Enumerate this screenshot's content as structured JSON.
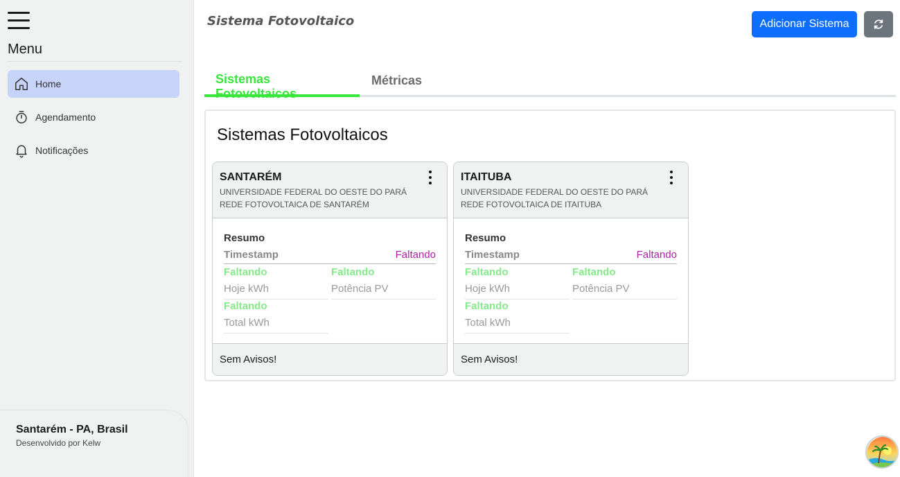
{
  "sidebar": {
    "menu_title": "Menu",
    "items": [
      {
        "label": "Home",
        "icon": "home-icon"
      },
      {
        "label": "Agendamento",
        "icon": "stopwatch-icon"
      },
      {
        "label": "Notificações",
        "icon": "bell-icon"
      }
    ],
    "footer": {
      "city": "Santarém - PA, Brasil",
      "developer": "Desenvolvido por Kelw"
    }
  },
  "header": {
    "title": "Sistema Fotovoltaico",
    "add_button": "Adicionar Sistema",
    "refresh_icon": "refresh-icon"
  },
  "tabs": [
    {
      "label": "Sistemas Fotovoltaicos",
      "active": true
    },
    {
      "label": "Métricas",
      "active": false
    }
  ],
  "panel": {
    "title": "Sistemas Fotovoltaicos",
    "cards": [
      {
        "name": "SANTARÉM",
        "institution": "UNIVERSIDADE FEDERAL DO OESTE DO PARÁ",
        "network": "REDE FOTOVOLTAICA DE SANTARÉM",
        "summary_label": "Resumo",
        "timestamp_label": "Timestamp",
        "timestamp_value": "Faltando",
        "today_value": "Faltando",
        "today_label": "Hoje kWh",
        "power_value": "Faltando",
        "power_label": "Potência PV",
        "total_value": "Faltando",
        "total_label": "Total kWh",
        "footer": "Sem Avisos!"
      },
      {
        "name": "ITAITUBA",
        "institution": "UNIVERSIDADE FEDERAL DO OESTE DO PARÁ",
        "network": "REDE FOTOVOLTAICA DE ITAITUBA",
        "summary_label": "Resumo",
        "timestamp_label": "Timestamp",
        "timestamp_value": "Faltando",
        "today_value": "Faltando",
        "today_label": "Hoje kWh",
        "power_value": "Faltando",
        "power_label": "Potência PV",
        "total_value": "Faltando",
        "total_label": "Total kWh",
        "footer": "Sem Avisos!"
      }
    ]
  },
  "colors": {
    "accent_green": "#39e63c",
    "missing_green": "#86e98a",
    "missing_magenta": "#b01fa8",
    "primary_blue": "#0d6efd",
    "secondary_gray": "#6c757d",
    "active_nav": "#c8d3fa"
  }
}
